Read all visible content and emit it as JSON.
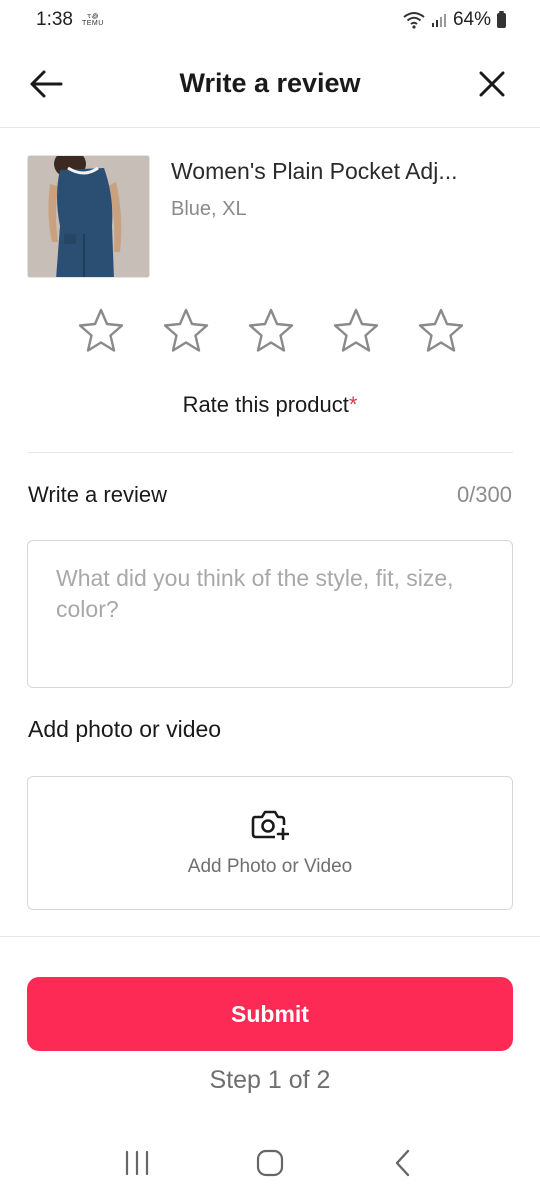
{
  "status_bar": {
    "time": "1:38",
    "app_badge_top": "ꚍ꩜",
    "app_badge_bottom": "TEMU",
    "battery_percent": "64%"
  },
  "header": {
    "title": "Write a review"
  },
  "product": {
    "name": "Women's Plain Pocket Adj...",
    "variant": "Blue, XL"
  },
  "rating": {
    "label": "Rate this product",
    "required_mark": "*",
    "max_stars": 5,
    "selected_stars": 0
  },
  "review": {
    "heading": "Write a review",
    "counter": "0/300",
    "placeholder": "What did you think of the style, fit, size, color?",
    "value": ""
  },
  "media": {
    "heading": "Add photo or video",
    "button_label": "Add Photo or Video",
    "icon": "camera-add-icon"
  },
  "submit": {
    "label": "Submit",
    "step": "Step 1 of 2"
  },
  "colors": {
    "accent": "#fd2a55",
    "required": "#e8334e",
    "muted_text": "#8c8c8c"
  }
}
